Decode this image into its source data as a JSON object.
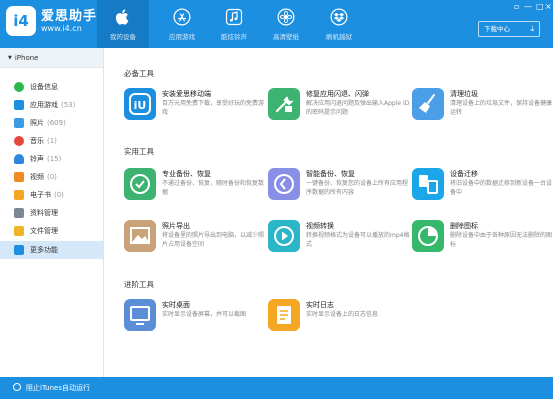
{
  "app": {
    "name": "爱思助手",
    "url": "www.i4.cn",
    "badge": "i4"
  },
  "nav": {
    "tabs": [
      {
        "label": "我的设备",
        "icon": "apple-icon",
        "active": true
      },
      {
        "label": "应用游戏",
        "icon": "app-store-icon",
        "active": false
      },
      {
        "label": "酷炫铃声",
        "icon": "music-note-icon",
        "active": false
      },
      {
        "label": "高清壁纸",
        "icon": "flower-icon",
        "active": false
      },
      {
        "label": "刷机越狱",
        "icon": "dropbox-icon",
        "active": false
      }
    ],
    "download_label": "下载中心"
  },
  "sidebar": {
    "device": "iPhone",
    "items": [
      {
        "label": "设备信息",
        "count": "",
        "icon": "info-icon",
        "color": "#2db84d"
      },
      {
        "label": "应用游戏",
        "count": "(53)",
        "icon": "apps-icon",
        "color": "#1d8fe1"
      },
      {
        "label": "照片",
        "count": "(609)",
        "icon": "photo-icon",
        "color": "#3a9be6"
      },
      {
        "label": "音乐",
        "count": "(1)",
        "icon": "music-icon",
        "color": "#e8453c"
      },
      {
        "label": "铃声",
        "count": "(15)",
        "icon": "bell-icon",
        "color": "#2e86de"
      },
      {
        "label": "视频",
        "count": "(0)",
        "icon": "video-icon",
        "color": "#f08a24"
      },
      {
        "label": "电子书",
        "count": "(0)",
        "icon": "ebook-icon",
        "color": "#f5a623"
      },
      {
        "label": "资料管理",
        "count": "",
        "icon": "data-icon",
        "color": "#7b8794"
      },
      {
        "label": "文件管理",
        "count": "",
        "icon": "folder-icon",
        "color": "#f0b429"
      },
      {
        "label": "更多功能",
        "count": "",
        "icon": "more-icon",
        "color": "#1d8fe1",
        "active": true
      }
    ]
  },
  "sections": {
    "essential": "必备工具",
    "practical": "实用工具",
    "advanced": "进阶工具"
  },
  "tools": [
    {
      "name": "安装爱思移动端",
      "desc": "百万元用免费下载，享受好玩的免费游戏",
      "icon": "i4-app-icon",
      "color": "#1d8fe1"
    },
    {
      "name": "修复应用闪退、闪弹",
      "desc": "解决应用闪退问题及弹出输入Apple ID的密码提示问题",
      "icon": "repair-icon",
      "color": "#3cb371"
    },
    {
      "name": "清理垃圾",
      "desc": "清理设备上的垃圾文件，保持设备健康运转",
      "icon": "broom-icon",
      "color": "#4a9fe8"
    },
    {
      "name": "专业备份、恢复",
      "desc": "不通过备份、恢复，随时备份和恢复数据",
      "icon": "backup-icon",
      "color": "#3cb371"
    },
    {
      "name": "智能备份、恢复",
      "desc": "一键备份、恢复您的设备上所有应用程序数据的所有内容",
      "icon": "smart-backup-icon",
      "color": "#8a8fe6"
    },
    {
      "name": "设备迁移",
      "desc": "将旧设备中的数据迁移到新设备一台设备中",
      "icon": "migrate-icon",
      "color": "#1aa6e8"
    },
    {
      "name": "照片导出",
      "desc": "将设备里的照片导出到电脑，以减少照片占用设备空间",
      "icon": "photo-export-icon",
      "color": "#c9a27a"
    },
    {
      "name": "视频转换",
      "desc": "转换视频格式为设备可以播放的mp4格式",
      "icon": "video-convert-icon",
      "color": "#2bb5c9"
    },
    {
      "name": "删除图标",
      "desc": "删除设备中由于各种原因无法删除的图标",
      "icon": "delete-icon",
      "color": "#35b86b"
    },
    {
      "name": "实时桌面",
      "desc": "实时显示设备屏幕，并可以截图",
      "icon": "screen-icon",
      "color": "#5a8fd8"
    },
    {
      "name": "实时日志",
      "desc": "实时显示设备上的日志信息",
      "icon": "log-icon",
      "color": "#f5a623"
    }
  ],
  "footer": {
    "label": "阻止iTunes自动运行"
  },
  "colors": {
    "brand": "#1d8fe1",
    "nav_active": "#157bc6",
    "sidebar_active": "#d4e8fa"
  }
}
